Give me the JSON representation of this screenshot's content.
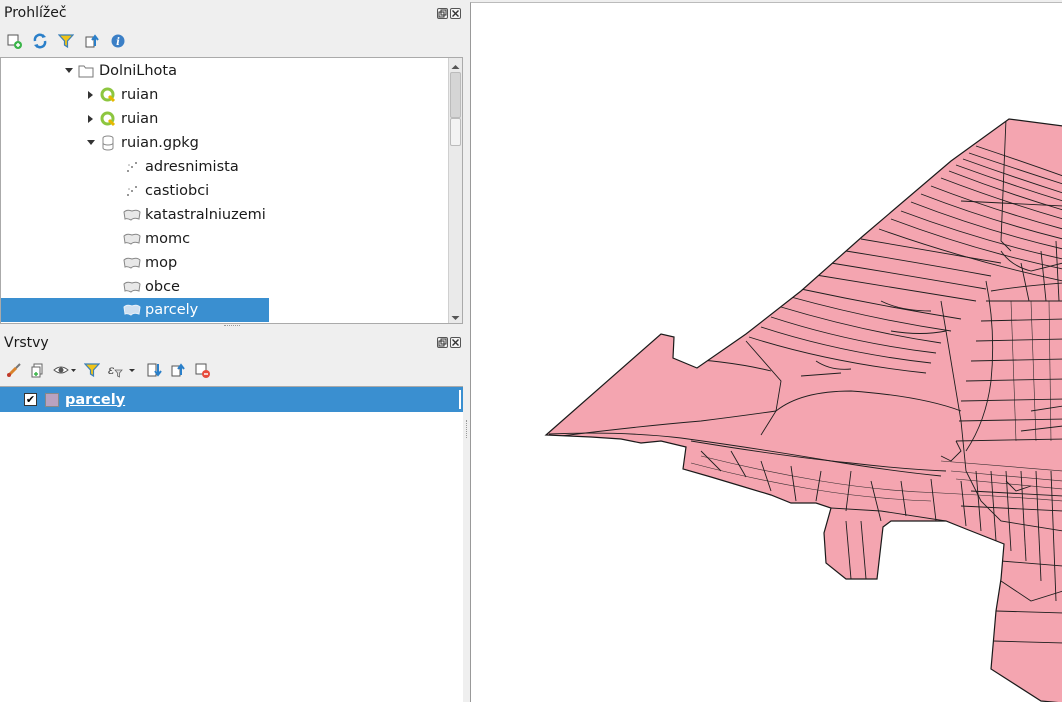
{
  "browser_panel": {
    "title": "Prohlížeč",
    "toolbar_icons": [
      "add-layer-icon",
      "refresh-icon",
      "filter-icon",
      "collapse-all-icon",
      "info-icon"
    ],
    "tree": [
      {
        "label": "DolniLhota",
        "icon": "folder-icon",
        "expanded": true,
        "level": 0
      },
      {
        "label": "ruian",
        "icon": "qgis-project-icon",
        "expanded": false,
        "level": 1
      },
      {
        "label": "ruian",
        "icon": "qgis-project-icon",
        "expanded": false,
        "level": 1
      },
      {
        "label": "ruian.gpkg",
        "icon": "geopackage-icon",
        "expanded": true,
        "level": 1
      },
      {
        "label": "adresnimista",
        "icon": "point-layer-icon",
        "level": 2
      },
      {
        "label": "castiobci",
        "icon": "point-layer-icon",
        "level": 2
      },
      {
        "label": "katastralniuzemi",
        "icon": "polygon-layer-icon",
        "level": 2
      },
      {
        "label": "momc",
        "icon": "polygon-layer-icon",
        "level": 2
      },
      {
        "label": "mop",
        "icon": "polygon-layer-icon",
        "level": 2
      },
      {
        "label": "obce",
        "icon": "polygon-layer-icon",
        "level": 2
      },
      {
        "label": "parcely",
        "icon": "polygon-layer-icon",
        "level": 2,
        "selected": true
      }
    ]
  },
  "layers_panel": {
    "title": "Vrstvy",
    "toolbar_icons": [
      "style-icon",
      "add-group-icon",
      "visibility-icon",
      "filter-icon",
      "expression-filter-icon",
      "expand-all-icon",
      "collapse-all-icon",
      "remove-layer-icon"
    ],
    "layers": [
      {
        "label": "parcely",
        "checked": true,
        "color": "#b9a2c0"
      }
    ]
  },
  "map_canvas": {
    "fill_color": "#f4a5b0",
    "stroke_color": "#1a1a1a"
  }
}
